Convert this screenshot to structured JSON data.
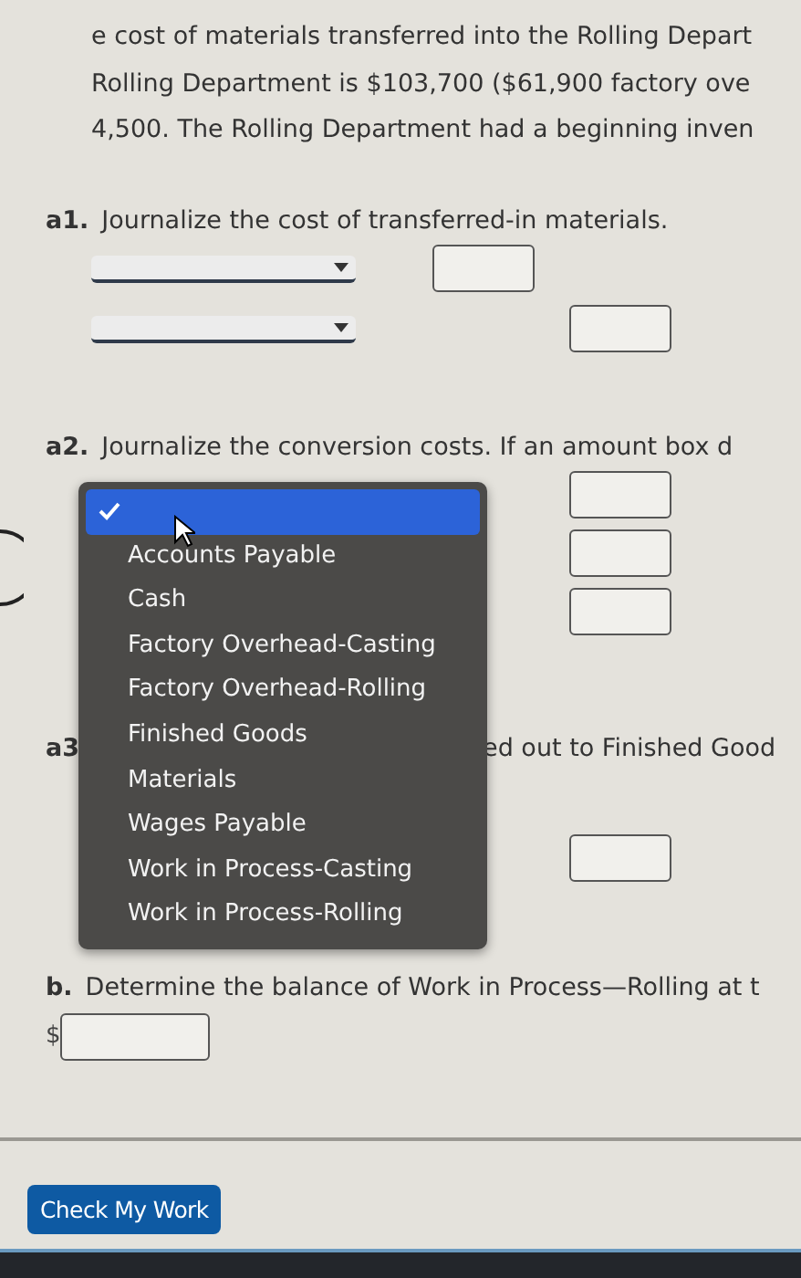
{
  "intro_lines": [
    "e cost of materials transferred into the Rolling Depart",
    "Rolling Department is $103,700 ($61,900 factory ove",
    "4,500. The Rolling Department had a beginning inven"
  ],
  "parts": [
    {
      "label": "a1.",
      "instruction": "Journalize the cost of transferred-in materials.",
      "entries": [
        {
          "kind": "debit"
        },
        {
          "kind": "credit"
        }
      ]
    },
    {
      "label": "a2.",
      "instruction": "Journalize the conversion costs. If an amount box d",
      "entries": [
        {
          "kind": "amount"
        },
        {
          "kind": "amount"
        },
        {
          "kind": "amount"
        }
      ]
    },
    {
      "label": "a3",
      "instruction": "ed out to Finished Good",
      "entries": [
        {
          "kind": "amount"
        }
      ]
    },
    {
      "label": "b.",
      "instruction": "Determine the balance of Work in Process—Rolling at t",
      "currency": "$"
    }
  ],
  "dropdown_menu": {
    "items": [
      {
        "selected": true
      },
      {
        "label": "Accounts Payable",
        "selected": false
      },
      {
        "label": "Cash",
        "selected": false
      },
      {
        "label": "Factory Overhead-Casting",
        "selected": false
      },
      {
        "label": "Factory Overhead-Rolling",
        "selected": false
      },
      {
        "label": "Finished Goods",
        "selected": false
      },
      {
        "label": "Materials",
        "selected": false
      },
      {
        "label": "Wages Payable",
        "selected": false
      },
      {
        "label": "Work in Process-Casting",
        "selected": false
      },
      {
        "label": "Work in Process-Rolling",
        "selected": false
      }
    ]
  },
  "button": "Check My Work"
}
